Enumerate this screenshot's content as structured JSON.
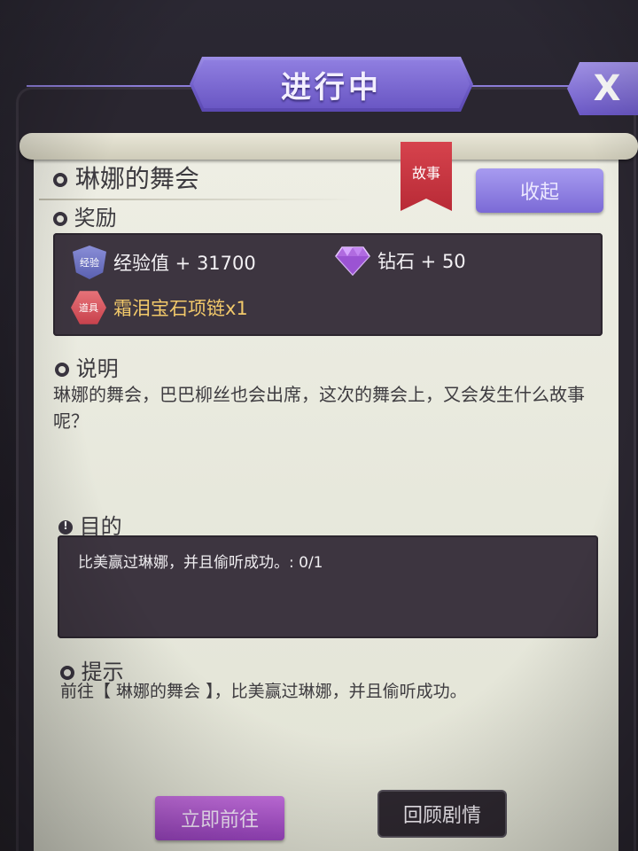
{
  "window": {
    "title": "进行中",
    "close_label": "X"
  },
  "quest": {
    "name": "琳娜的舞会",
    "tag": "故事",
    "collapse_label": "收起"
  },
  "rewards": {
    "heading": "奖励",
    "items": [
      {
        "badge": "经验",
        "label": "经验值 + 31700",
        "icon": "exp-shield-icon"
      },
      {
        "badge": "",
        "label": "钻石 + 50",
        "icon": "diamond-icon"
      },
      {
        "badge": "道具",
        "label": "霜泪宝石项链x1",
        "icon": "item-hex-icon",
        "color": "#f2c96a"
      }
    ]
  },
  "description": {
    "heading": "说明",
    "text": "琳娜的舞会，巴巴柳丝也会出席，这次的舞会上，又会发生什么故事呢？"
  },
  "objective": {
    "heading": "目的",
    "text": "比美赢过琳娜，并且偷听成功。: 0/1"
  },
  "hint": {
    "heading": "提示",
    "text": "前往【 琳娜的舞会 】，比美赢过琳娜，并且偷听成功。"
  },
  "actions": {
    "go_label": "立即前往",
    "review_label": "回顾剧情"
  },
  "colors": {
    "accent_purple": "#7b6ad6",
    "ribbon_red": "#c7343f",
    "panel_dark": "#3d3540",
    "paper": "#eaeadf"
  }
}
